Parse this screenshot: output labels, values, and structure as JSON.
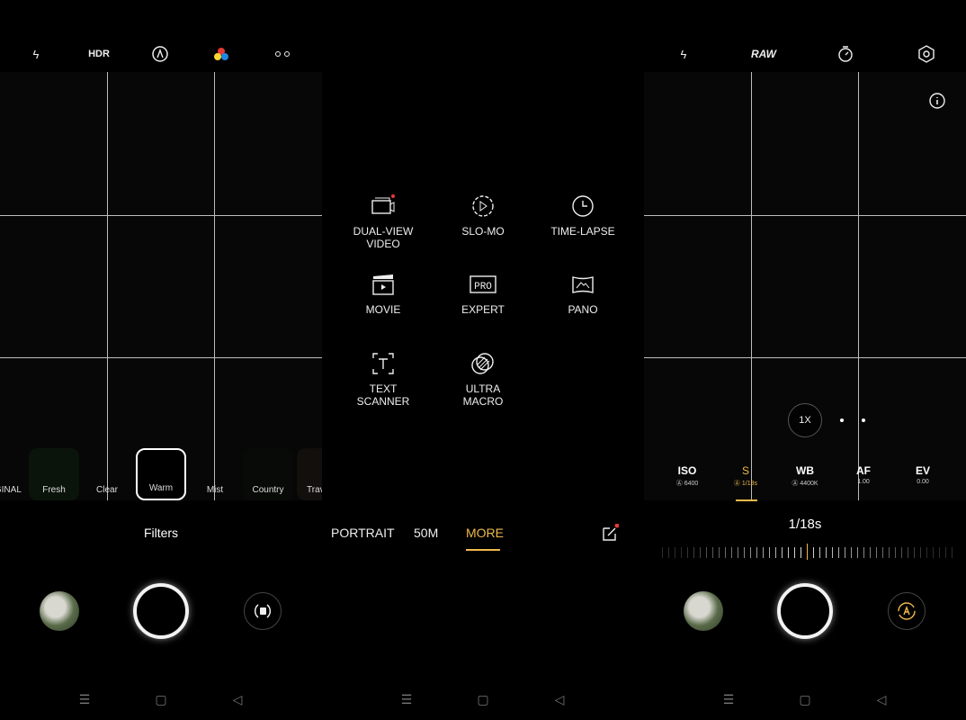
{
  "left": {
    "top_icons": [
      "flash-off-icon",
      "hdr-icon",
      "auto-icon",
      "color-filter-icon",
      "more-icon"
    ],
    "hdr_label": "HDR",
    "filters": [
      {
        "label": "ORIGINAL"
      },
      {
        "label": "Fresh"
      },
      {
        "label": "Clear"
      },
      {
        "label": "Warm",
        "selected": true
      },
      {
        "label": "Mist"
      },
      {
        "label": "Country"
      },
      {
        "label": "Travel"
      }
    ],
    "filters_title": "Filters"
  },
  "middle": {
    "modes": [
      {
        "label": "DUAL-VIEW\nVIDEO",
        "icon": "dual-view-icon",
        "badge": true
      },
      {
        "label": "SLO-MO",
        "icon": "slo-mo-icon"
      },
      {
        "label": "TIME-LAPSE",
        "icon": "time-lapse-icon"
      },
      {
        "label": "MOVIE",
        "icon": "clapper-icon"
      },
      {
        "label": "EXPERT",
        "icon": "pro-icon",
        "icon_text": "PRO"
      },
      {
        "label": "PANO",
        "icon": "pano-icon"
      },
      {
        "label": "TEXT\nSCANNER",
        "icon": "text-scanner-icon"
      },
      {
        "label": "ULTRA\nMACRO",
        "icon": "macro-icon"
      }
    ],
    "mode_bar": [
      "PORTRAIT",
      "50M",
      "MORE"
    ],
    "active_mode": "MORE",
    "accent": "#f0b94a"
  },
  "right": {
    "raw_label": "RAW",
    "zoom": "1X",
    "params": [
      {
        "name": "ISO",
        "value": "6400",
        "auto": true
      },
      {
        "name": "S",
        "value": "1/18s",
        "auto": true,
        "active": true
      },
      {
        "name": "WB",
        "value": "4400K",
        "auto": true
      },
      {
        "name": "AF",
        "value": "1.00"
      },
      {
        "name": "EV",
        "value": "0.00"
      }
    ],
    "shutter_value": "1/18s"
  },
  "nav": [
    "menu-icon",
    "home-icon",
    "back-icon"
  ]
}
